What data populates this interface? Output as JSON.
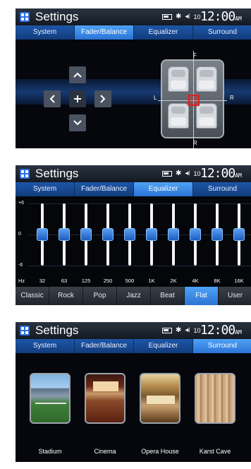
{
  "screens": [
    {
      "header": {
        "title": "Settings",
        "volume_text": "10",
        "clock": "12:00",
        "ampm": "AM"
      },
      "tabs": [
        "System",
        "Fader/Balance",
        "Equalizer",
        "Surround"
      ],
      "active_tab": "Fader/Balance",
      "fader_balance": {
        "axis_labels": {
          "front": "F",
          "rear": "R",
          "left": "L",
          "right": "R"
        },
        "buttons": {
          "up": "^",
          "left": "<",
          "center": "+",
          "right": ">",
          "down": "v"
        }
      }
    },
    {
      "header": {
        "title": "Settings",
        "volume_text": "10",
        "clock": "12:00",
        "ampm": "AM"
      },
      "tabs": [
        "System",
        "Fader/Balance",
        "Equalizer",
        "Surround"
      ],
      "active_tab": "Equalizer",
      "equalizer": {
        "scale": [
          "+6",
          "0",
          "-6"
        ],
        "hz_label": "Hz",
        "bands": [
          {
            "freq": "32",
            "level_db": 0
          },
          {
            "freq": "63",
            "level_db": 0
          },
          {
            "freq": "125",
            "level_db": 0
          },
          {
            "freq": "250",
            "level_db": 0
          },
          {
            "freq": "500",
            "level_db": 0
          },
          {
            "freq": "1K",
            "level_db": 0
          },
          {
            "freq": "2K",
            "level_db": 0
          },
          {
            "freq": "4K",
            "level_db": 0
          },
          {
            "freq": "8K",
            "level_db": 0
          },
          {
            "freq": "16K",
            "level_db": 0
          }
        ],
        "presets": [
          "Classic",
          "Rock",
          "Pop",
          "Jazz",
          "Beat",
          "Flat",
          "User"
        ],
        "active_preset": "Flat"
      }
    },
    {
      "header": {
        "title": "Settings",
        "volume_text": "10",
        "clock": "12:00",
        "ampm": "AM"
      },
      "tabs": [
        "System",
        "Fader/Balance",
        "Equalizer",
        "Surround"
      ],
      "active_tab": "Surround",
      "surround": {
        "modes": [
          "Stadium",
          "Cinema",
          "Opera House",
          "Karst Cave"
        ]
      }
    }
  ],
  "colors": {
    "tab_active": "#3a8ae8",
    "tab_bar": "#1a4f9a",
    "eq_knob": "#2f7ae0",
    "balance_marker": "#e02020"
  }
}
